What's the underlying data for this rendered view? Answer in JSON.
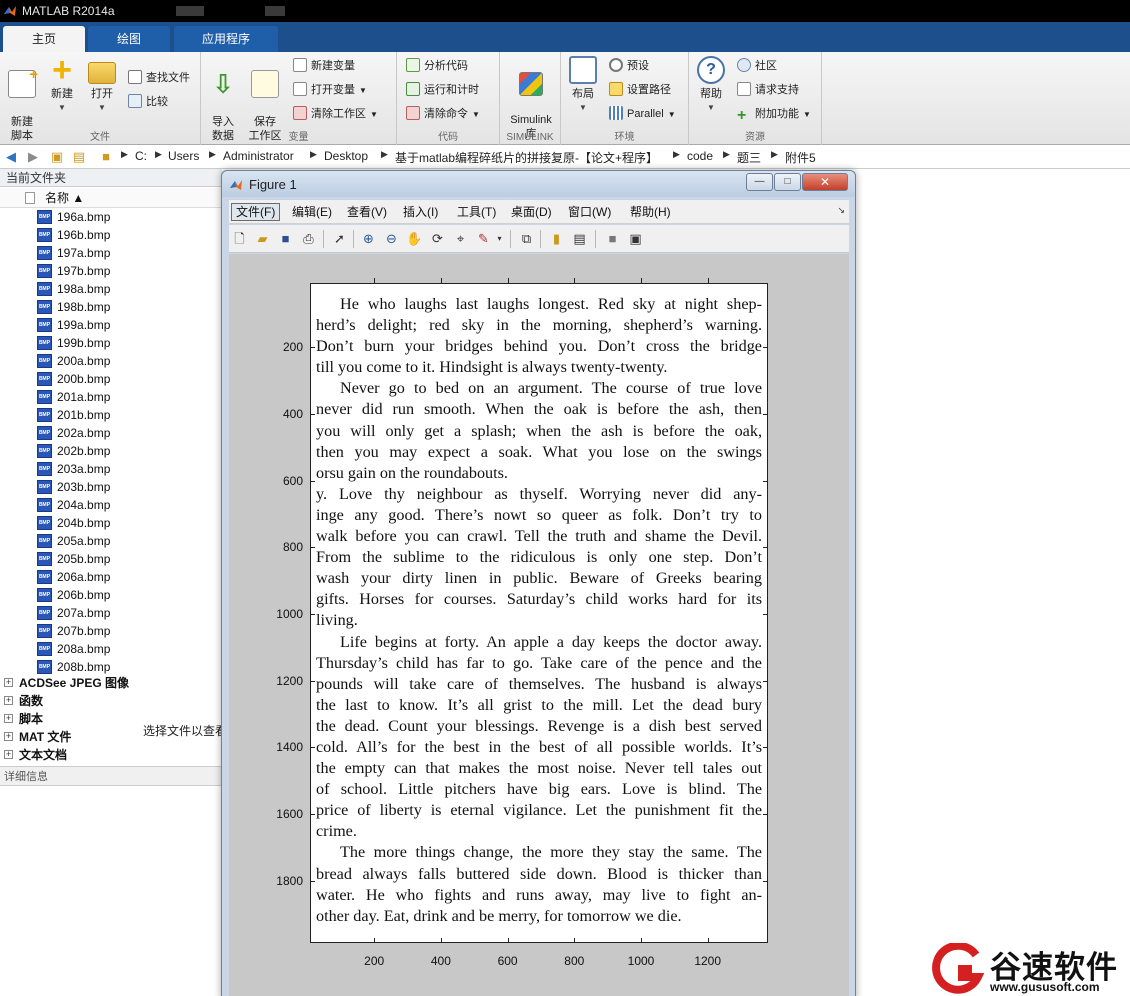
{
  "app": {
    "title": "MATLAB R2014a"
  },
  "ribbon": {
    "tabs": [
      {
        "label": "主页"
      },
      {
        "label": "绘图"
      },
      {
        "label": "应用程序"
      }
    ],
    "groups": {
      "file": {
        "label": "文件",
        "new_script": "新建\n脚本",
        "new": "新建",
        "open": "打开",
        "find_files": "查找文件",
        "compare": "比较"
      },
      "variable": {
        "label": "变量",
        "import_data": "导入\n数据",
        "save_workspace": "保存\n工作区",
        "new_variable": "新建变量",
        "open_variable": "打开变量",
        "clear_workspace": "清除工作区"
      },
      "code": {
        "label": "代码",
        "analyze_code": "分析代码",
        "run_and_time": "运行和计时",
        "clear_commands": "清除命令"
      },
      "simulink": {
        "label": "SIMULINK",
        "library": "Simulink\n库"
      },
      "environment": {
        "label": "环境",
        "layout": "布局",
        "preferences": "预设",
        "set_path": "设置路径",
        "parallel": "Parallel"
      },
      "resources": {
        "label": "资源",
        "help": "帮助",
        "community": "社区",
        "request_support": "请求支持",
        "add_ons": "附加功能"
      }
    }
  },
  "address": {
    "segments": [
      "C:",
      "Users",
      "Administrator",
      "Desktop",
      "基于matlab编程碎纸片的拼接复原-【论文+程序】",
      "code",
      "题三",
      "附件5"
    ]
  },
  "file_panel": {
    "title": "当前文件夹",
    "column_header": "名称 ▲",
    "files": [
      "196a.bmp",
      "196b.bmp",
      "197a.bmp",
      "197b.bmp",
      "198a.bmp",
      "198b.bmp",
      "199a.bmp",
      "199b.bmp",
      "200a.bmp",
      "200b.bmp",
      "201a.bmp",
      "201b.bmp",
      "202a.bmp",
      "202b.bmp",
      "203a.bmp",
      "203b.bmp",
      "204a.bmp",
      "204b.bmp",
      "205a.bmp",
      "205b.bmp",
      "206a.bmp",
      "206b.bmp",
      "207a.bmp",
      "207b.bmp",
      "208a.bmp",
      "208b.bmp"
    ],
    "file_icon_text": "BMP",
    "categories": [
      "ACDSee JPEG 图像",
      "函数",
      "脚本",
      "MAT 文件",
      "文本文档"
    ],
    "details_title": "详细信息",
    "details_message": "选择文件以查看详细信息"
  },
  "figure": {
    "title": "Figure 1",
    "window_buttons": {
      "minimize": "—",
      "maximize": "□",
      "close": "✕"
    },
    "menu": [
      "文件(F)",
      "编辑(E)",
      "查看(V)",
      "插入(I)",
      "工具(T)",
      "桌面(D)",
      "窗口(W)",
      "帮助(H)"
    ],
    "y_ticks": [
      "200",
      "400",
      "600",
      "800",
      "1000",
      "1200",
      "1400",
      "1600",
      "1800"
    ],
    "x_ticks": [
      "200",
      "400",
      "600",
      "800",
      "1000",
      "1200"
    ],
    "document_lines": [
      "He who laughs last laughs longest. Red sky at night shep-",
      "herd’s delight; red sky in the morning, shepherd’s warning.",
      "Don’t burn your bridges behind you. Don’t cross the bridge",
      "till you come to it. Hindsight is always twenty-twenty.",
      "Never go to bed on an argument. The course of true love",
      "never did run smooth. When the oak is before the ash, then",
      "you will only get a splash; when the ash is before the oak,",
      "then you may expect a soak. What you lose on the swings",
      "orsu gain on the roundabouts.",
      "y. Love thy neighbour as thyself. Worrying never did any-",
      "inge any good. There’s nowt so queer as folk. Don’t try to",
      "walk before you can crawl. Tell the truth and shame the Devil.",
      "From the sublime to the ridiculous is only one step. Don’t",
      "wash your dirty linen in public. Beware of Greeks bearing",
      "gifts. Horses for courses. Saturday’s child works hard for its",
      "living.",
      "Life begins at forty. An apple a day keeps the doctor away.",
      "Thursday’s child has far to go. Take care of the pence and the",
      "pounds will take care of themselves. The husband is always",
      "the last to know. It’s all grist to the mill. Let the dead bury",
      "the dead. Count your blessings. Revenge is a dish best served",
      "cold. All’s for the best in the best of all possible worlds. It’s",
      "the empty can that makes the most noise. Never tell tales out",
      "of school. Little pitchers have big ears. Love is blind. The",
      "price of liberty is eternal vigilance. Let the punishment fit the",
      "crime.",
      "The more things change, the more they stay the same. The",
      "bread always falls buttered side down. Blood is thicker than",
      "water. He who fights and runs away, may live to fight an-",
      "other day. Eat, drink and be merry, for tomorrow we die."
    ]
  },
  "watermark": {
    "brand": "谷速软件",
    "url": "www.gususoft.com"
  }
}
